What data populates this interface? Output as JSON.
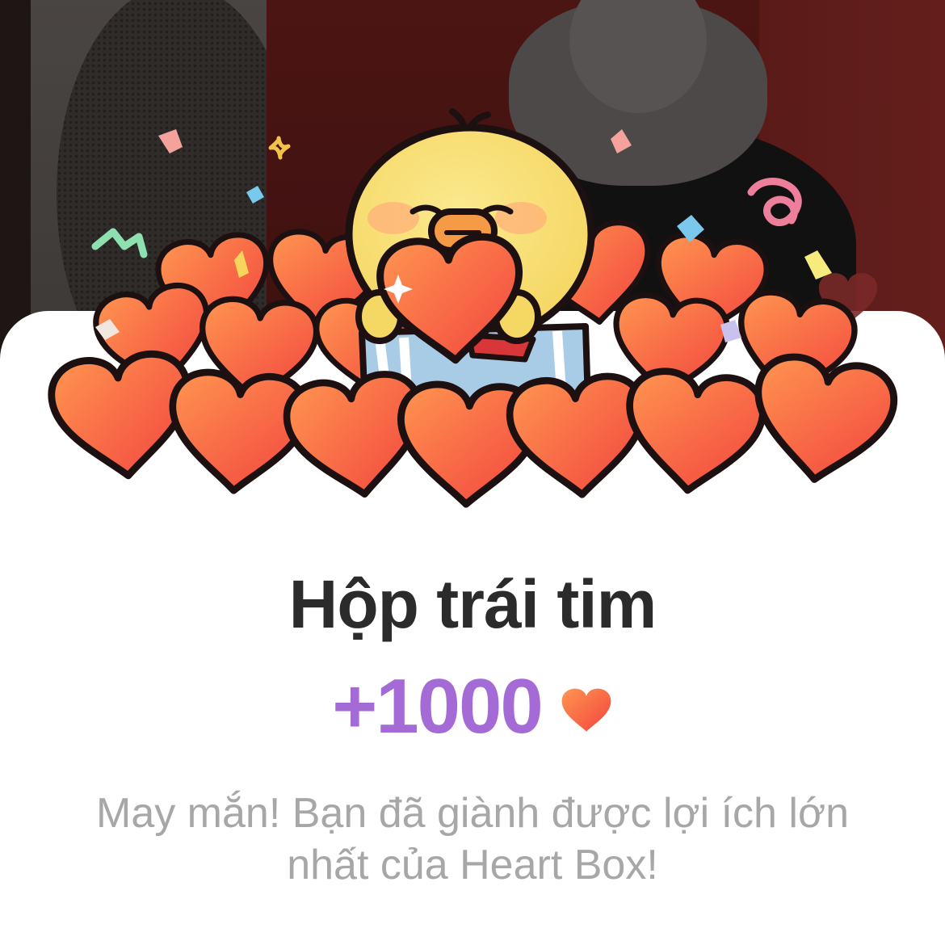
{
  "dialog": {
    "title": "Hộp trái tim",
    "reward_amount": "+1000",
    "reward_icon": "heart-icon",
    "message": "May mắn! Bạn đã giành được lợi ích lớn nhất của Heart Box!"
  },
  "colors": {
    "title": "#2b2b2b",
    "reward": "#a46ad6",
    "message": "#a7a7a7",
    "heart_top": "#ff8a4c",
    "heart_bottom": "#f5473f",
    "chick": "#f7dd74"
  }
}
